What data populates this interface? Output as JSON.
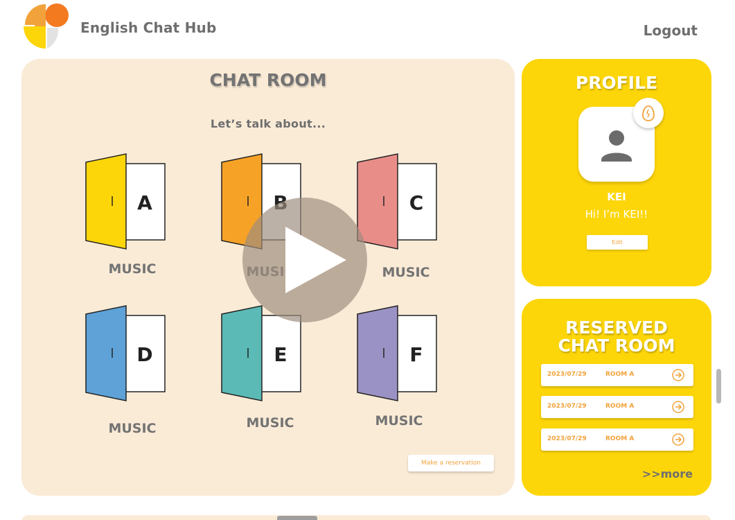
{
  "header": {
    "app_title": "English Chat Hub",
    "logout_label": "Logout",
    "logo_colors": [
      "#f47a20",
      "#f2a23a",
      "#fdd60a",
      "#dcdcdc"
    ]
  },
  "chat_room": {
    "title": "CHAT ROOM",
    "subtitle": "Let’s talk about...",
    "rooms": [
      {
        "letter": "A",
        "topic": "MUSIC",
        "door_color": "#fdd60a"
      },
      {
        "letter": "B",
        "topic": "MUSIC",
        "door_color": "#f6a227"
      },
      {
        "letter": "C",
        "topic": "MUSIC",
        "door_color": "#e98d89"
      },
      {
        "letter": "D",
        "topic": "MUSIC",
        "door_color": "#5ea2d8"
      },
      {
        "letter": "E",
        "topic": "MUSIC",
        "door_color": "#5bbab5"
      },
      {
        "letter": "F",
        "topic": "MUSIC",
        "door_color": "#9a92c4"
      }
    ],
    "reserve_button": "Make a reservation",
    "panel_color": "#faebd7"
  },
  "profile": {
    "title": "PROFILE",
    "name": "KEI",
    "bio": "Hi! I’m KEI!!",
    "edit_label": "Edit",
    "badge_icon": "egg-icon",
    "panel_color": "#fdd60a"
  },
  "reserved": {
    "title_line1": "RESERVED",
    "title_line2": "CHAT ROOM",
    "items": [
      {
        "date": "2023/07/29",
        "room": "ROOM A"
      },
      {
        "date": "2023/07/29",
        "room": "ROOM A"
      },
      {
        "date": "2023/07/29",
        "room": "ROOM A"
      }
    ],
    "more_label": ">>more",
    "accent_color": "#f2a23a"
  },
  "overlay": {
    "icon": "play-icon"
  }
}
